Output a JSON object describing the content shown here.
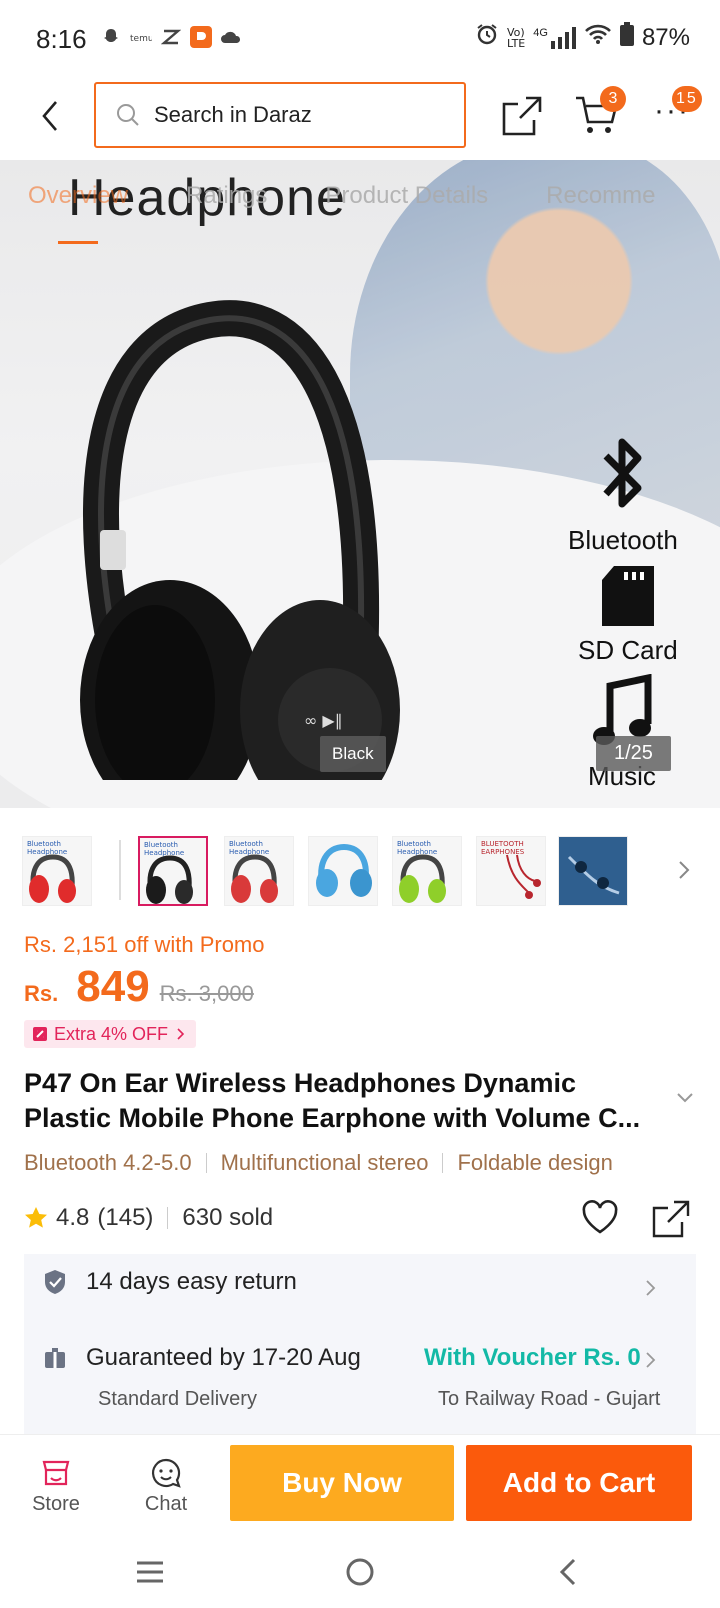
{
  "status_bar": {
    "time": "8:16",
    "network": "4G",
    "battery": "87%"
  },
  "header": {
    "search_placeholder": "Search in Daraz",
    "cart_count": "3",
    "more_count": "15"
  },
  "hero": {
    "image_title": "Headphone",
    "tabs": [
      {
        "label": "Overview"
      },
      {
        "label": "Ratings"
      },
      {
        "label": "Product Details"
      },
      {
        "label": "Recomme"
      }
    ],
    "features": [
      {
        "label": "Bluetooth",
        "icon": "bluetooth-icon"
      },
      {
        "label": "SD Card",
        "icon": "sd-card-icon"
      },
      {
        "label": "Music",
        "icon": "music-note-icon"
      }
    ],
    "variant": "Black",
    "page_counter": "1/25"
  },
  "thumbnails": [
    {
      "label": "Bluetooth Headphone",
      "color": "#e02c2c"
    },
    {
      "label": "Bluetooth Headphone",
      "color": "#1b1b1b"
    },
    {
      "label": "Bluetooth Headphone",
      "color": "#d93a3a"
    },
    {
      "label": "",
      "color": "#4aa6e0"
    },
    {
      "label": "Bluetooth Headphone",
      "color": "#8fcf2a"
    },
    {
      "label": "BLUETOOTH EARPHONES",
      "color": "#b8262e"
    },
    {
      "label": "",
      "color": "#2f5f8f"
    }
  ],
  "price": {
    "promo_text": "Rs. 2,151 off with Promo",
    "currency": "Rs.",
    "current": "849",
    "original": "Rs. 3,000",
    "extra_offer": "Extra 4% OFF"
  },
  "product": {
    "title": "P47 On Ear Wireless Headphones Dynamic Plastic Mobile Phone Earphone with Volume C...",
    "attributes": [
      "Bluetooth 4.2-5.0",
      "Multifunctional stereo",
      "Foldable design"
    ],
    "rating": "4.8",
    "reviews": "(145)",
    "sold": "630 sold"
  },
  "info": {
    "return_policy": "14 days easy return",
    "delivery_guarantee": "Guaranteed by 17-20 Aug",
    "voucher": "With Voucher Rs. 0",
    "delivery_type": "Standard Delivery",
    "address": "To Railway Road - Gujart"
  },
  "actions": {
    "store": "Store",
    "chat": "Chat",
    "buy_now": "Buy Now",
    "add_to_cart": "Add to Cart"
  },
  "colors": {
    "accent": "#f36a1c",
    "buy_now": "#fdaa1f",
    "add_to_cart": "#fb5a0c",
    "voucher": "#13b9a6",
    "attribute_text": "#a0714b"
  }
}
